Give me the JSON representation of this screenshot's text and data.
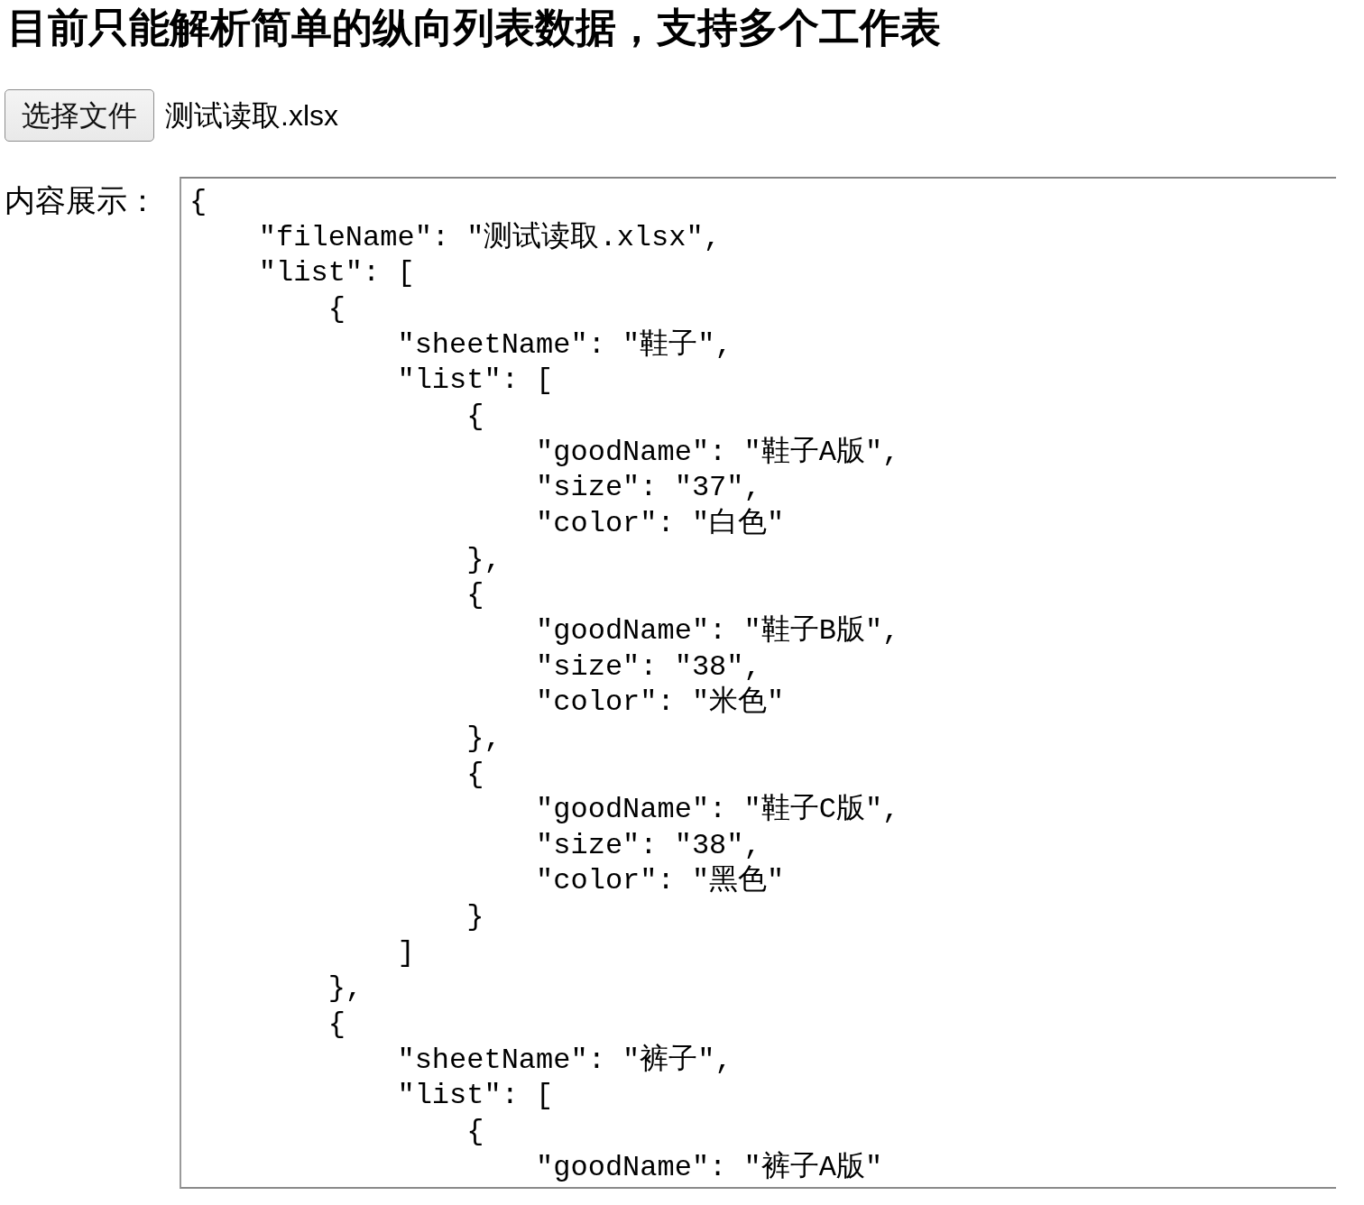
{
  "heading": "目前只能解析简单的纵向列表数据，支持多个工作表",
  "file_picker": {
    "button": "选择文件",
    "file_name": "测试读取.xlsx"
  },
  "content_display": {
    "label": "内容展示：",
    "value": "{\n    \"fileName\": \"测试读取.xlsx\",\n    \"list\": [\n        {\n            \"sheetName\": \"鞋子\",\n            \"list\": [\n                {\n                    \"goodName\": \"鞋子A版\",\n                    \"size\": \"37\",\n                    \"color\": \"白色\"\n                },\n                {\n                    \"goodName\": \"鞋子B版\",\n                    \"size\": \"38\",\n                    \"color\": \"米色\"\n                },\n                {\n                    \"goodName\": \"鞋子C版\",\n                    \"size\": \"38\",\n                    \"color\": \"黑色\"\n                }\n            ]\n        },\n        {\n            \"sheetName\": \"裤子\",\n            \"list\": [\n                {\n                    \"goodName\": \"裤子A版\""
  }
}
